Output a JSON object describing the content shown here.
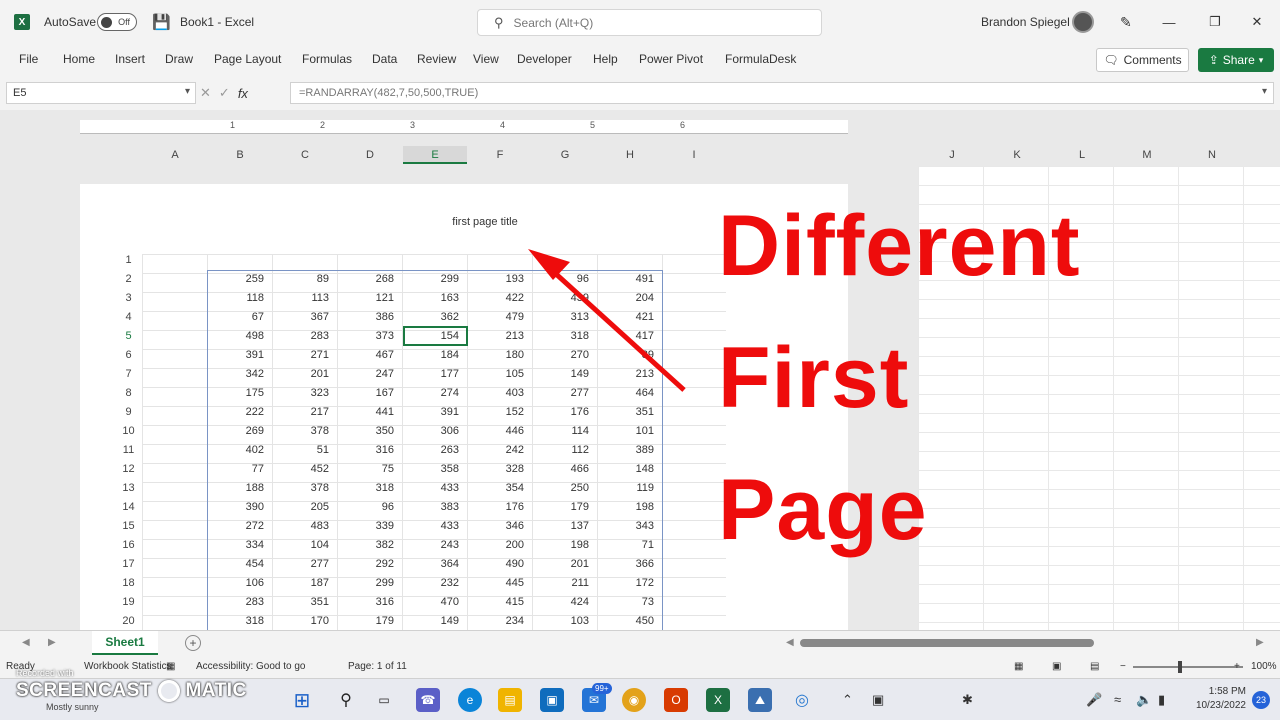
{
  "titlebar": {
    "autosave_label": "AutoSave",
    "autosave_state": "Off",
    "book_title": "Book1 - Excel",
    "search_placeholder": "Search (Alt+Q)",
    "user_name": "Brandon Spiegel"
  },
  "ribbon": {
    "tabs": [
      "File",
      "Home",
      "Insert",
      "Draw",
      "Page Layout",
      "Formulas",
      "Data",
      "Review",
      "View",
      "Developer",
      "Help",
      "Power Pivot",
      "FormulaDesk"
    ],
    "comments_label": "Comments",
    "share_label": "Share"
  },
  "formula_bar": {
    "name_box": "E5",
    "formula": "=RANDARRAY(482,7,50,500,TRUE)"
  },
  "ruler": {
    "numbers": [
      "1",
      "2",
      "3",
      "4",
      "5",
      "6"
    ]
  },
  "columns": [
    "A",
    "B",
    "C",
    "D",
    "E",
    "F",
    "G",
    "H",
    "I"
  ],
  "columns_page2": [
    "J",
    "K",
    "L",
    "M",
    "N"
  ],
  "page": {
    "title": "first page title"
  },
  "rows": [
    "1",
    "2",
    "3",
    "4",
    "5",
    "6",
    "7",
    "8",
    "9",
    "10",
    "11",
    "12",
    "13",
    "14",
    "15",
    "16",
    "17",
    "18",
    "19",
    "20"
  ],
  "grid": [
    [
      "259",
      "89",
      "268",
      "299",
      "193",
      "96",
      "491"
    ],
    [
      "118",
      "113",
      "121",
      "163",
      "422",
      "439",
      "204"
    ],
    [
      "67",
      "367",
      "386",
      "362",
      "479",
      "313",
      "421"
    ],
    [
      "498",
      "283",
      "373",
      "154",
      "213",
      "318",
      "417"
    ],
    [
      "391",
      "271",
      "467",
      "184",
      "180",
      "270",
      "89"
    ],
    [
      "342",
      "201",
      "247",
      "177",
      "105",
      "149",
      "213"
    ],
    [
      "175",
      "323",
      "167",
      "274",
      "403",
      "277",
      "464"
    ],
    [
      "222",
      "217",
      "441",
      "391",
      "152",
      "176",
      "351"
    ],
    [
      "269",
      "378",
      "350",
      "306",
      "446",
      "114",
      "101"
    ],
    [
      "402",
      "51",
      "316",
      "263",
      "242",
      "112",
      "389"
    ],
    [
      "77",
      "452",
      "75",
      "358",
      "328",
      "466",
      "148"
    ],
    [
      "188",
      "378",
      "318",
      "433",
      "354",
      "250",
      "119"
    ],
    [
      "390",
      "205",
      "96",
      "383",
      "176",
      "179",
      "198"
    ],
    [
      "272",
      "483",
      "339",
      "433",
      "346",
      "137",
      "343"
    ],
    [
      "334",
      "104",
      "382",
      "243",
      "200",
      "198",
      "71"
    ],
    [
      "454",
      "277",
      "292",
      "364",
      "490",
      "201",
      "366"
    ],
    [
      "106",
      "187",
      "299",
      "232",
      "445",
      "211",
      "172"
    ],
    [
      "283",
      "351",
      "316",
      "470",
      "415",
      "424",
      "73"
    ],
    [
      "318",
      "170",
      "179",
      "149",
      "234",
      "103",
      "450"
    ]
  ],
  "overlay": {
    "line1": "Different",
    "line2": "First",
    "line3": "Page",
    "color": "#ee0c0c"
  },
  "sheet_tabs": {
    "active": "Sheet1"
  },
  "status": {
    "ready": "Ready",
    "workbook_stats": "Workbook Statistics",
    "accessibility": "Accessibility: Good to go",
    "page_info": "Page: 1 of 11",
    "zoom": "100%"
  },
  "taskbar": {
    "time": "1:58 PM",
    "date": "10/23/2022",
    "notifications": "23",
    "mail_badge": "99+"
  },
  "watermark": {
    "text": "SCREENCAST",
    "suffix": "MATIC",
    "recorded": "Recorded with",
    "weather": "Mostly sunny"
  },
  "colors": {
    "accent": "#1a7a41",
    "brand_red": "#ee0c0c"
  }
}
